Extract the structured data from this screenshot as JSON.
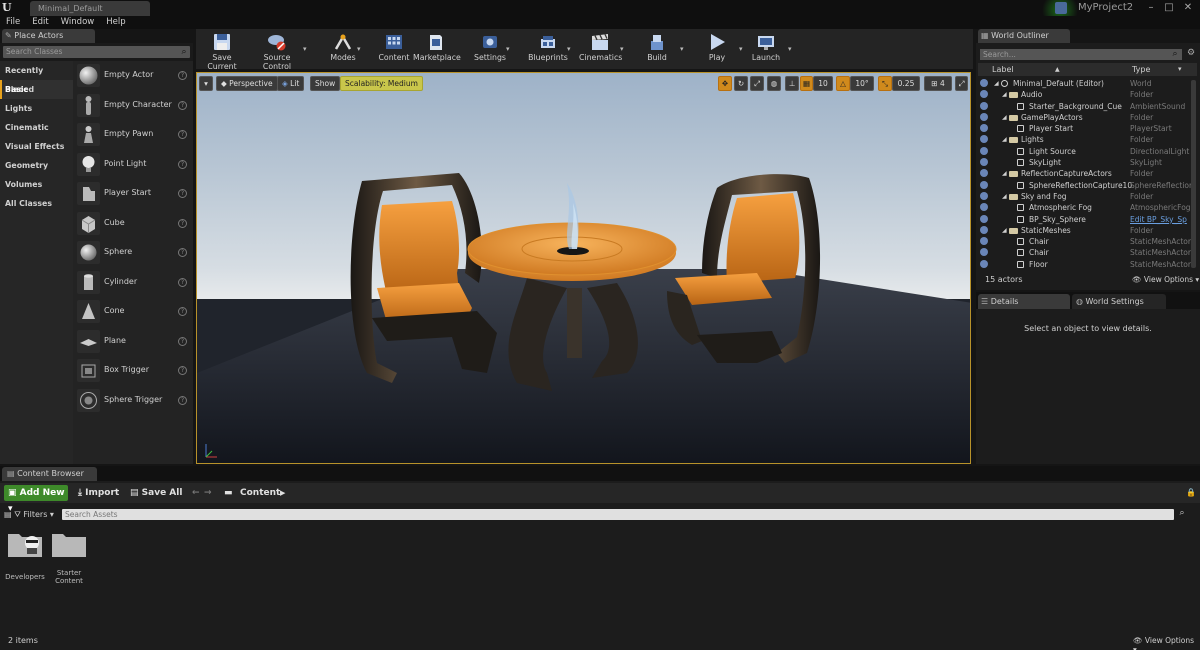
{
  "titlebar": {
    "doc_tab": "Minimal_Default",
    "project_name": "MyProject2",
    "min": "–",
    "max": "□",
    "close": "✕"
  },
  "menu": [
    "File",
    "Edit",
    "Window",
    "Help"
  ],
  "place_actors": {
    "tab_label": "Place Actors",
    "search_placeholder": "Search Classes",
    "categories": [
      "Recently Placed",
      "Basic",
      "Lights",
      "Cinematic",
      "Visual Effects",
      "Geometry",
      "Volumes",
      "All Classes"
    ],
    "active_category": "Basic",
    "actors": [
      "Empty Actor",
      "Empty Character",
      "Empty Pawn",
      "Point Light",
      "Player Start",
      "Cube",
      "Sphere",
      "Cylinder",
      "Cone",
      "Plane",
      "Box Trigger",
      "Sphere Trigger"
    ]
  },
  "toolbar": {
    "save_current": "Save Current",
    "source_control": "Source Control",
    "modes": "Modes",
    "content": "Content",
    "marketplace": "Marketplace",
    "settings": "Settings",
    "blueprints": "Blueprints",
    "cinematics": "Cinematics",
    "build": "Build",
    "play": "Play",
    "launch": "Launch"
  },
  "viewport": {
    "perspective": "Perspective",
    "lit": "Lit",
    "show": "Show",
    "scalability": "Scalability: Medium",
    "grid_snap": "10",
    "rotation_snap": "10°",
    "scale_snap": "0.25",
    "camera_speed": "4"
  },
  "outliner": {
    "tab_label": "World Outliner",
    "search_placeholder": "Search...",
    "col_label": "Label",
    "col_type": "Type",
    "rows": [
      {
        "label": "Minimal_Default (Editor)",
        "type": "World",
        "kind": "world",
        "indent": 0
      },
      {
        "label": "Audio",
        "type": "Folder",
        "kind": "folder",
        "indent": 1
      },
      {
        "label": "Starter_Background_Cue",
        "type": "AmbientSound",
        "kind": "actor",
        "indent": 2
      },
      {
        "label": "GamePlayActors",
        "type": "Folder",
        "kind": "folder",
        "indent": 1
      },
      {
        "label": "Player Start",
        "type": "PlayerStart",
        "kind": "actor",
        "indent": 2
      },
      {
        "label": "Lights",
        "type": "Folder",
        "kind": "folder",
        "indent": 1
      },
      {
        "label": "Light Source",
        "type": "DirectionalLight",
        "kind": "actor",
        "indent": 2
      },
      {
        "label": "SkyLight",
        "type": "SkyLight",
        "kind": "actor",
        "indent": 2
      },
      {
        "label": "ReflectionCaptureActors",
        "type": "Folder",
        "kind": "folder",
        "indent": 1
      },
      {
        "label": "SphereReflectionCapture10",
        "type": "SphereReflection",
        "kind": "actor",
        "indent": 2
      },
      {
        "label": "Sky and Fog",
        "type": "Folder",
        "kind": "folder",
        "indent": 1
      },
      {
        "label": "Atmospheric Fog",
        "type": "AtmosphericFog",
        "kind": "actor",
        "indent": 2
      },
      {
        "label": "BP_Sky_Sphere",
        "type": "Edit BP_Sky_Sp",
        "kind": "actor",
        "indent": 2,
        "link": true
      },
      {
        "label": "StaticMeshes",
        "type": "Folder",
        "kind": "folder",
        "indent": 1
      },
      {
        "label": "Chair",
        "type": "StaticMeshActor",
        "kind": "actor",
        "indent": 2
      },
      {
        "label": "Chair",
        "type": "StaticMeshActor",
        "kind": "actor",
        "indent": 2
      },
      {
        "label": "Floor",
        "type": "StaticMeshActor",
        "kind": "actor",
        "indent": 2
      }
    ],
    "actor_count": "15 actors",
    "view_options": "View Options"
  },
  "details": {
    "tab_label": "Details",
    "world_settings_label": "World Settings",
    "empty_message": "Select an object to view details."
  },
  "content_browser": {
    "tab_label": "Content Browser",
    "add_new": "Add New",
    "import": "Import",
    "save_all": "Save All",
    "path": "Content",
    "filters": "Filters",
    "search_placeholder": "Search Assets",
    "folders": [
      "Developers",
      "Starter Content"
    ],
    "item_count": "2 items",
    "view_options": "View Options"
  },
  "colors": {
    "accent": "#e8a21c",
    "add_new": "#3e8a2a",
    "scalability": "#c9c64b"
  }
}
